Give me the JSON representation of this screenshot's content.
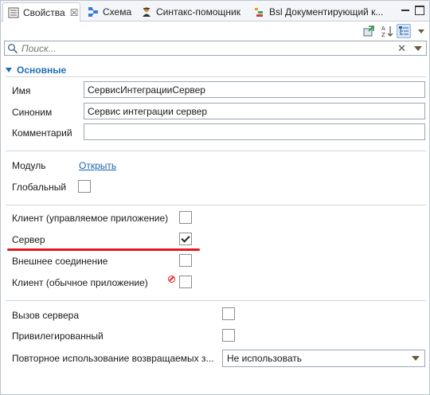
{
  "tabs": [
    {
      "label": "Свойства",
      "icon": "properties-icon",
      "active": true
    },
    {
      "label": "Схема",
      "icon": "schema-icon"
    },
    {
      "label": "Синтакс-помощник",
      "icon": "syntax-helper-icon"
    },
    {
      "label": "Bsl Документирующий к...",
      "icon": "bsl-doc-icon"
    }
  ],
  "tab_close_glyph": "☒",
  "search": {
    "placeholder": "Поиск...",
    "clear_glyph": "✕"
  },
  "section": {
    "title": "Основные"
  },
  "fields": {
    "name": {
      "label": "Имя",
      "value": "СервисИнтеграцииСервер"
    },
    "synonym": {
      "label": "Синоним",
      "value": "Сервис интеграции сервер"
    },
    "comment": {
      "label": "Комментарий",
      "value": ""
    }
  },
  "module": {
    "label": "Модуль",
    "link": "Открыть"
  },
  "global": {
    "label": "Глобальный",
    "checked": false
  },
  "context_flags": [
    {
      "label": "Клиент (управляемое приложение)",
      "checked": false
    },
    {
      "label": "Сервер",
      "checked": true
    },
    {
      "label": "Внешнее соединение",
      "checked": false
    },
    {
      "label": "Клиент (обычное приложение)",
      "checked": false
    }
  ],
  "server_call": {
    "label": "Вызов сервера",
    "checked": false
  },
  "privileged": {
    "label": "Привилегированный",
    "checked": false
  },
  "reuse": {
    "label": "Повторное использование возвращаемых з...",
    "value": "Не использовать"
  },
  "colors": {
    "accent": "#1f6fb5",
    "highlight": "#e3191f"
  }
}
